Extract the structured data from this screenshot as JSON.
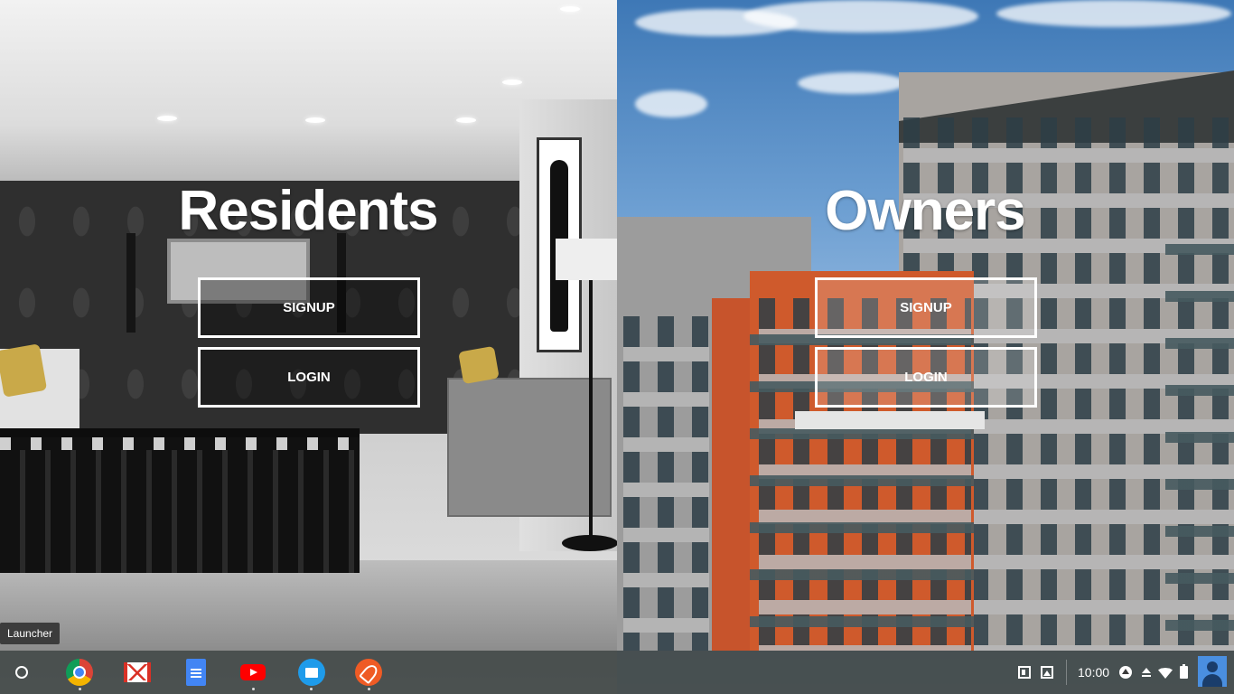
{
  "residents": {
    "title": "Residents",
    "signup_label": "SIGNUP",
    "login_label": "LOGIN"
  },
  "owners": {
    "title": "Owners",
    "signup_label": "SIGNUP",
    "login_label": "LOGIN"
  },
  "tooltip": {
    "text": "Launcher"
  },
  "shelf": {
    "apps": [
      {
        "name": "Chrome",
        "icon": "chrome-icon"
      },
      {
        "name": "Gmail",
        "icon": "gmail-icon"
      },
      {
        "name": "Docs",
        "icon": "docs-icon"
      },
      {
        "name": "YouTube",
        "icon": "youtube-icon"
      },
      {
        "name": "Files",
        "icon": "files-icon"
      },
      {
        "name": "Postman",
        "icon": "postman-icon"
      }
    ],
    "tray": {
      "clock": "10:00"
    }
  }
}
